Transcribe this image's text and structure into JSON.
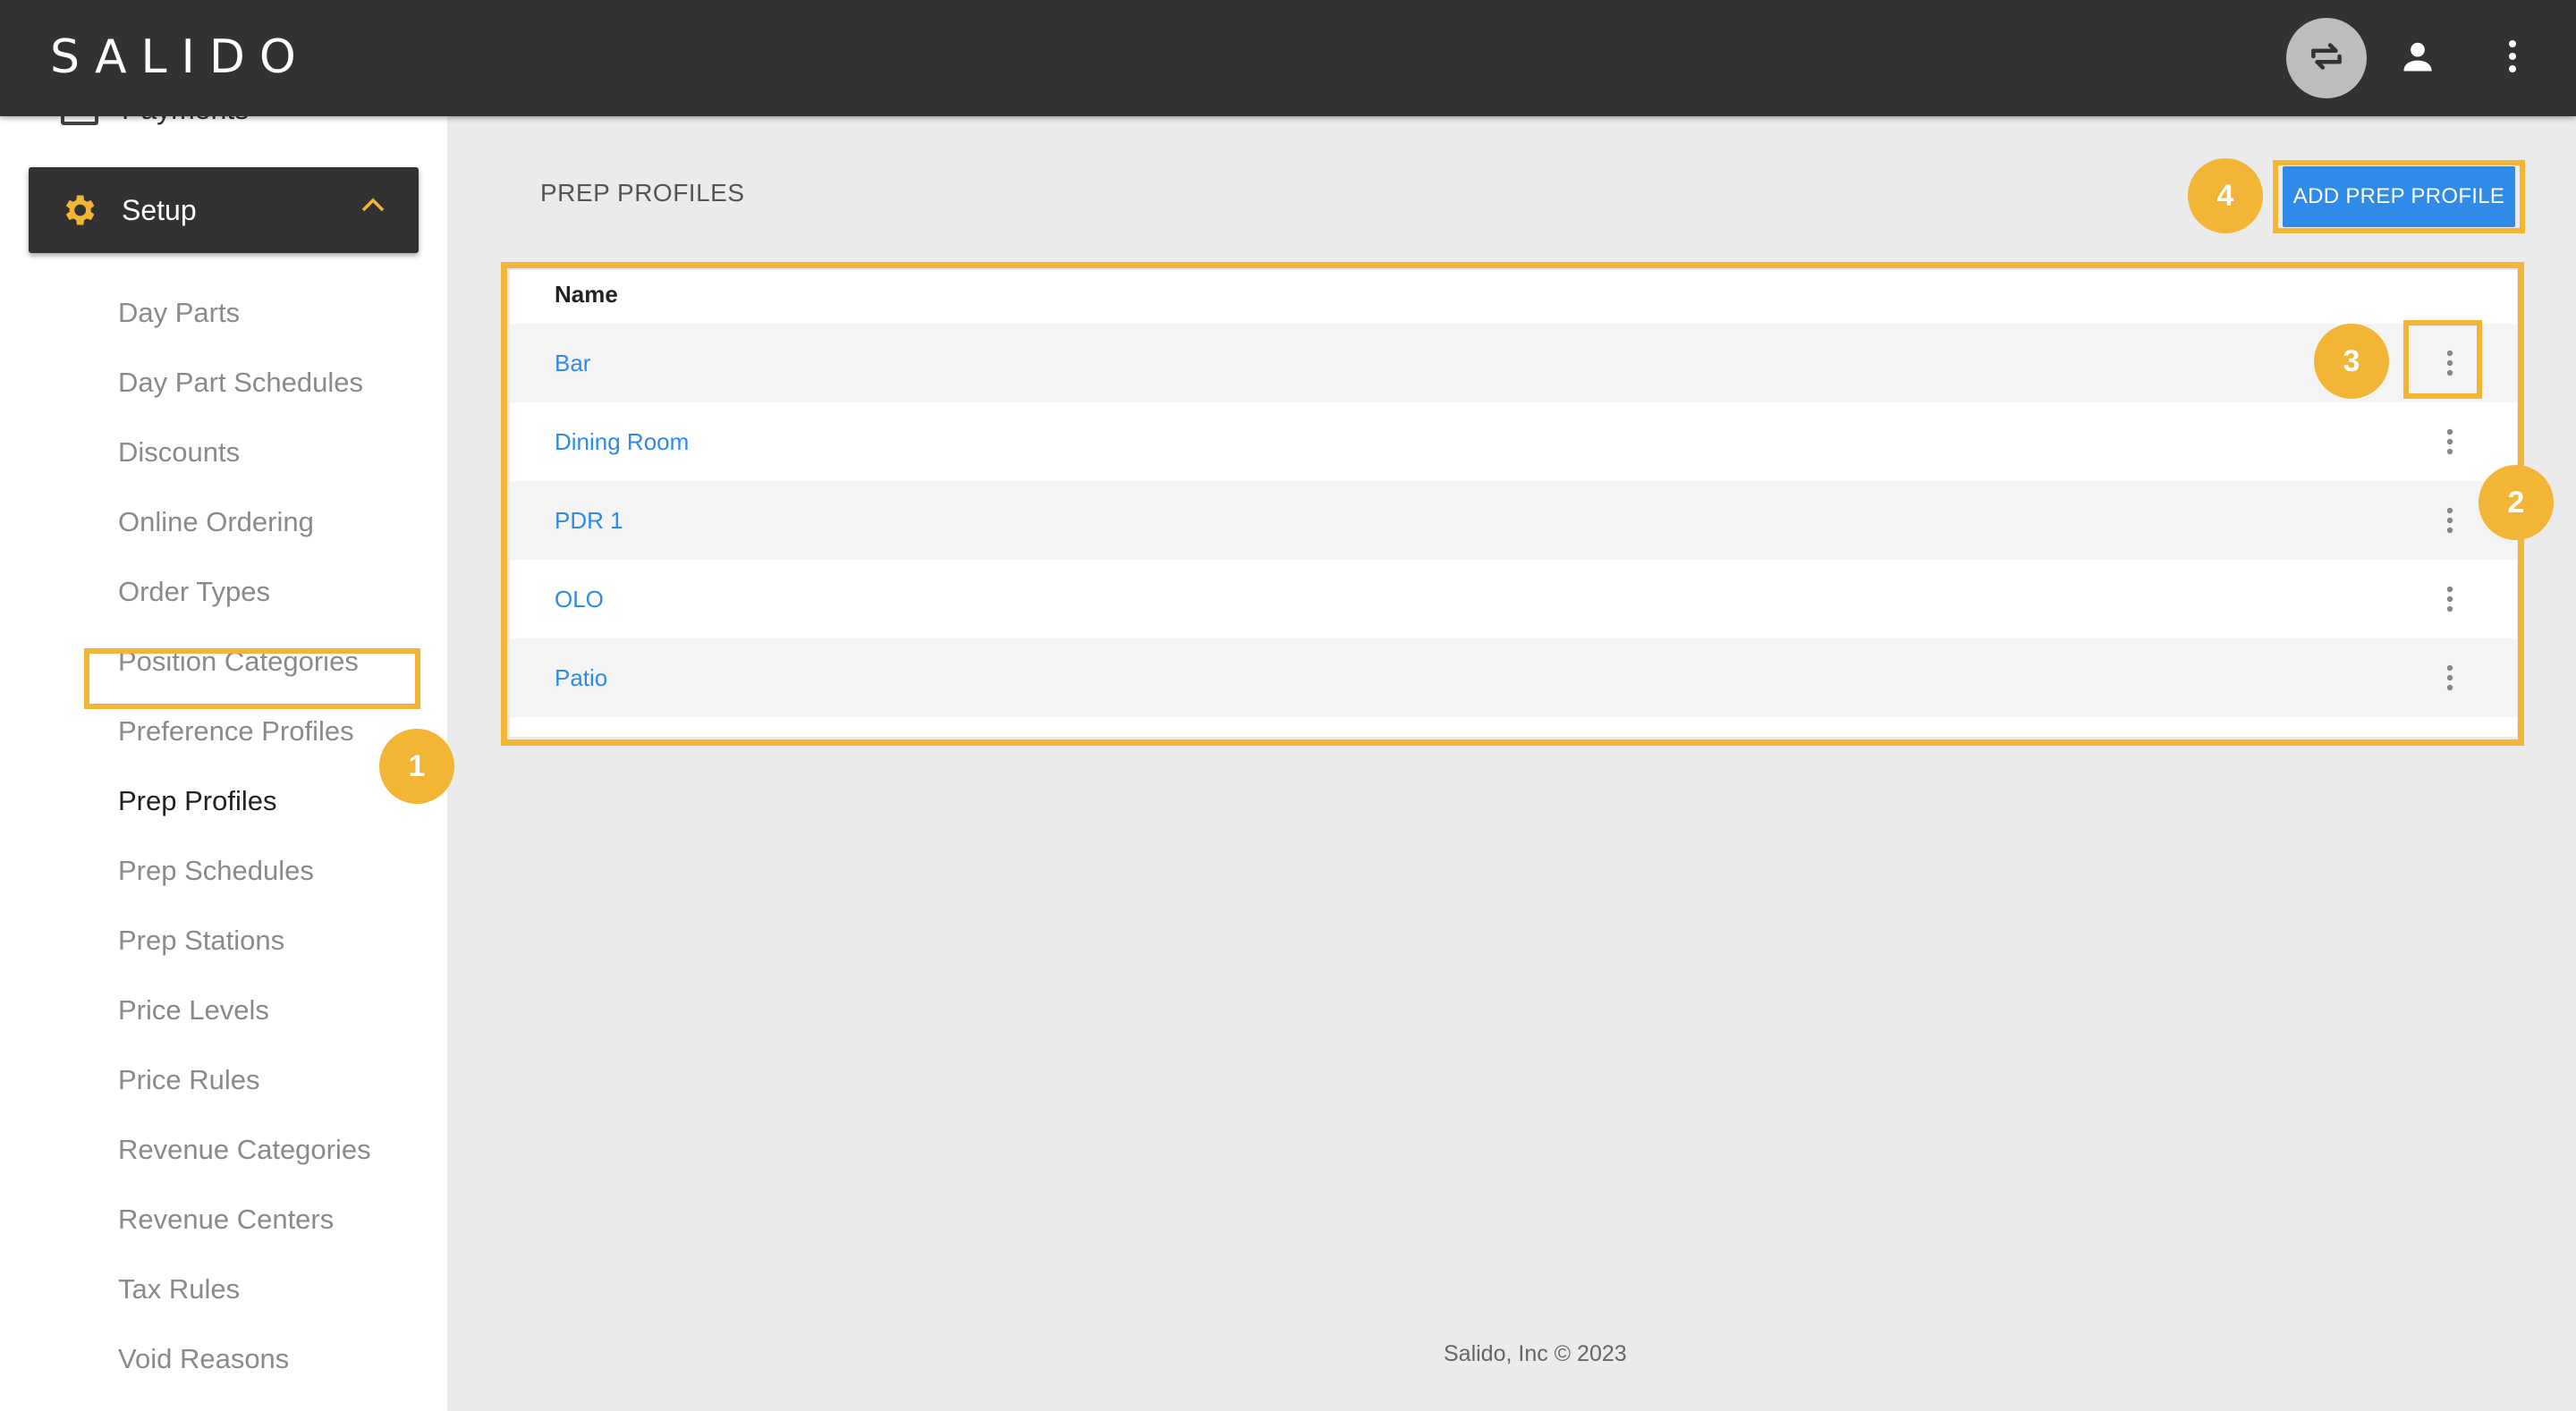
{
  "app": {
    "logo": "SALIDO"
  },
  "topbar": {
    "icons": [
      "swap-icon",
      "user-icon",
      "more-vertical-icon"
    ]
  },
  "sidebar": {
    "payments_label": "Payments",
    "setup_label": "Setup",
    "items": [
      {
        "label": "Day Parts"
      },
      {
        "label": "Day Part Schedules"
      },
      {
        "label": "Discounts"
      },
      {
        "label": "Online Ordering"
      },
      {
        "label": "Order Types"
      },
      {
        "label": "Position Categories"
      },
      {
        "label": "Preference Profiles"
      },
      {
        "label": "Prep Profiles",
        "active": true
      },
      {
        "label": "Prep Schedules"
      },
      {
        "label": "Prep Stations"
      },
      {
        "label": "Price Levels"
      },
      {
        "label": "Price Rules"
      },
      {
        "label": "Revenue Categories"
      },
      {
        "label": "Revenue Centers"
      },
      {
        "label": "Tax Rules"
      },
      {
        "label": "Void Reasons"
      }
    ]
  },
  "main": {
    "title": "PREP PROFILES",
    "add_button": "ADD PREP PROFILE",
    "table": {
      "header_name": "Name",
      "rows": [
        {
          "name": "Bar"
        },
        {
          "name": "Dining Room"
        },
        {
          "name": "PDR 1"
        },
        {
          "name": "OLO"
        },
        {
          "name": "Patio"
        }
      ]
    }
  },
  "annotations": {
    "badge_1": "1",
    "badge_2": "2",
    "badge_3": "3",
    "badge_4": "4"
  },
  "footer": {
    "text": "Salido, Inc © 2023"
  },
  "colors": {
    "topbar": "#323232",
    "highlight": "#f2b535",
    "link": "#2f8ae8",
    "gear": "#f2b535"
  }
}
